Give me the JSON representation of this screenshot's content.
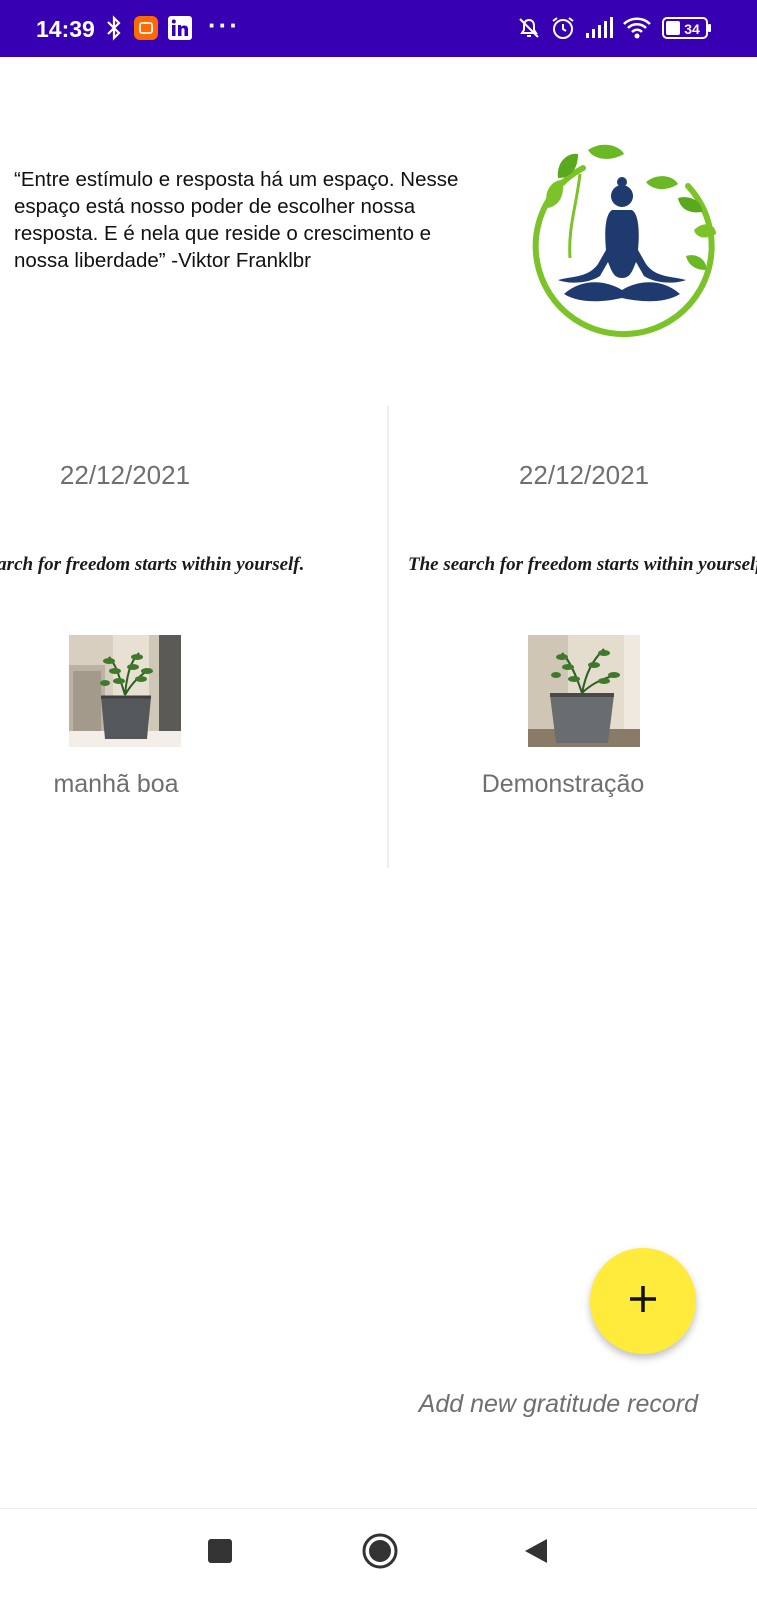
{
  "status_bar": {
    "time": "14:39",
    "battery": "34",
    "more": "···",
    "icons": [
      "bluetooth-icon",
      "mi-app-icon",
      "linkedin-icon",
      "mute-icon",
      "alarm-icon",
      "signal-icon",
      "wifi-icon",
      "battery-icon"
    ],
    "background": "#3700b3"
  },
  "header": {
    "quote": "“Entre estímulo e resposta há um espaço. Nesse espaço está nosso poder de escolher nossa resposta. E é nela que reside o crescimento e nossa liberdade” -Viktor Franklbr",
    "logo_icon": "meditation-logo-icon"
  },
  "records": [
    {
      "date": "22/12/2021",
      "phrase": "The search for freedom starts within yourself.",
      "caption": "manhã boa"
    },
    {
      "date": "22/12/2021",
      "phrase": "The search for freedom starts within yourself.",
      "caption": "Demonstração"
    }
  ],
  "fab": {
    "icon": "plus-icon",
    "label": "Add new gratitude record",
    "color": "#ffeb3b"
  },
  "nav_bar": {
    "icons": [
      "recents-square-icon",
      "home-circle-icon",
      "back-triangle-icon"
    ]
  }
}
